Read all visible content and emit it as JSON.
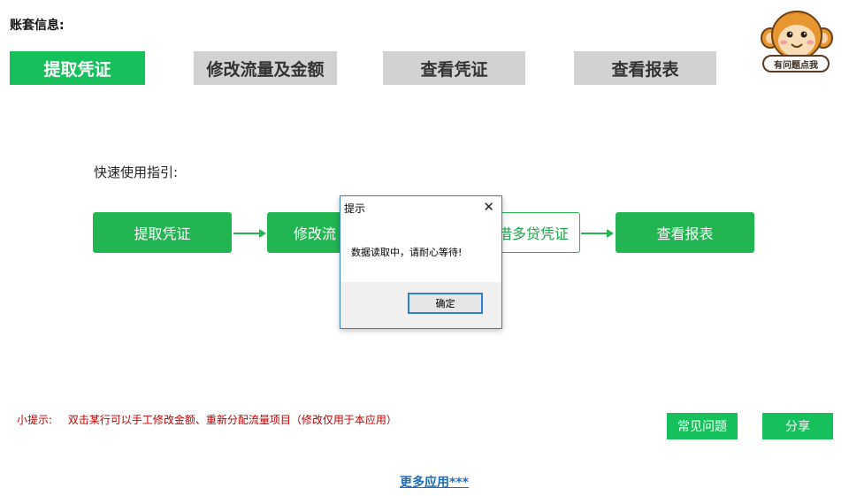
{
  "header": {
    "title": "账套信息:"
  },
  "tabs": [
    {
      "label": "提取凭证",
      "active": true
    },
    {
      "label": "修改流量及金额",
      "active": false
    },
    {
      "label": "查看凭证",
      "active": false
    },
    {
      "label": "查看报表",
      "active": false
    }
  ],
  "help": {
    "label": "有问题点我",
    "icon": "monkey-icon"
  },
  "guide": {
    "label": "快速使用指引:",
    "steps": [
      "提取凭证",
      "修改流量及金额",
      "借多贷凭证",
      "查看报表"
    ],
    "visible_step_texts": [
      "提取凭证",
      "修改流",
      "借多贷凭证",
      "查看报表"
    ]
  },
  "tip": {
    "prefix": "小提示:",
    "text": "双击某行可以手工修改金额、重新分配流量项目（修改仅用于本应用）"
  },
  "buttons": {
    "faq": "常见问题",
    "share": "分享"
  },
  "more_link": "更多应用***",
  "dialog": {
    "title": "提示",
    "message": "数据读取中，请耐心等待!",
    "ok_label": "确定",
    "close_icon": "close-icon"
  },
  "colors": {
    "active_tab": "#16c05a",
    "inactive_tab": "#d2d2d2",
    "flow_green": "#22b552",
    "tip_red": "#c00000",
    "link_blue": "#1a6fb8"
  }
}
